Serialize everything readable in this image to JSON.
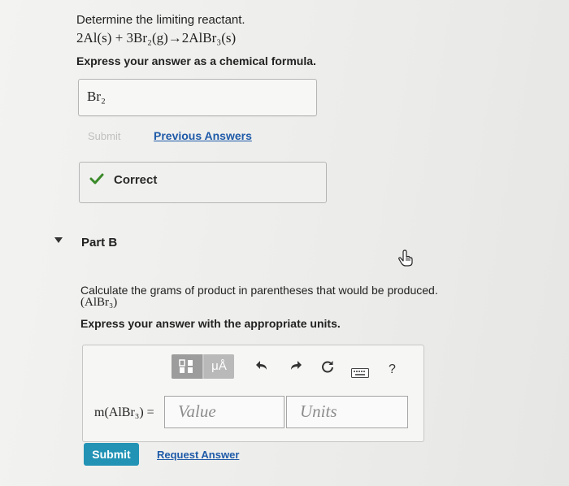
{
  "part_a": {
    "question": "Determine the limiting reactant.",
    "equation": "2Al(s) + 3Br₂(g)→2AlBr₃(s)",
    "instruction": "Express your answer as a chemical formula.",
    "answer": "Br₂",
    "submit_label": "Submit",
    "previous_answers_label": "Previous Answers",
    "feedback": "Correct"
  },
  "part_b": {
    "title": "Part B",
    "question": "Calculate the grams of product in parentheses that would be produced.",
    "product": "(AlBr₃)",
    "instruction": "Express your answer with the appropriate units.",
    "toolbar": {
      "mu_label": "μÅ",
      "help": "?"
    },
    "input_label": "m(AlBr₃) =",
    "value_placeholder": "Value",
    "units_placeholder": "Units",
    "submit_label": "Submit",
    "request_answer_label": "Request Answer"
  },
  "colors": {
    "link": "#1e5aa8",
    "submit": "#2293b5",
    "correct_check": "#3a8a2a"
  },
  "icons": [
    "check-icon",
    "collapse-triangle-icon",
    "hand-cursor-icon",
    "templates-icon",
    "undo-icon",
    "redo-icon",
    "reset-icon",
    "keyboard-icon",
    "help-icon"
  ]
}
